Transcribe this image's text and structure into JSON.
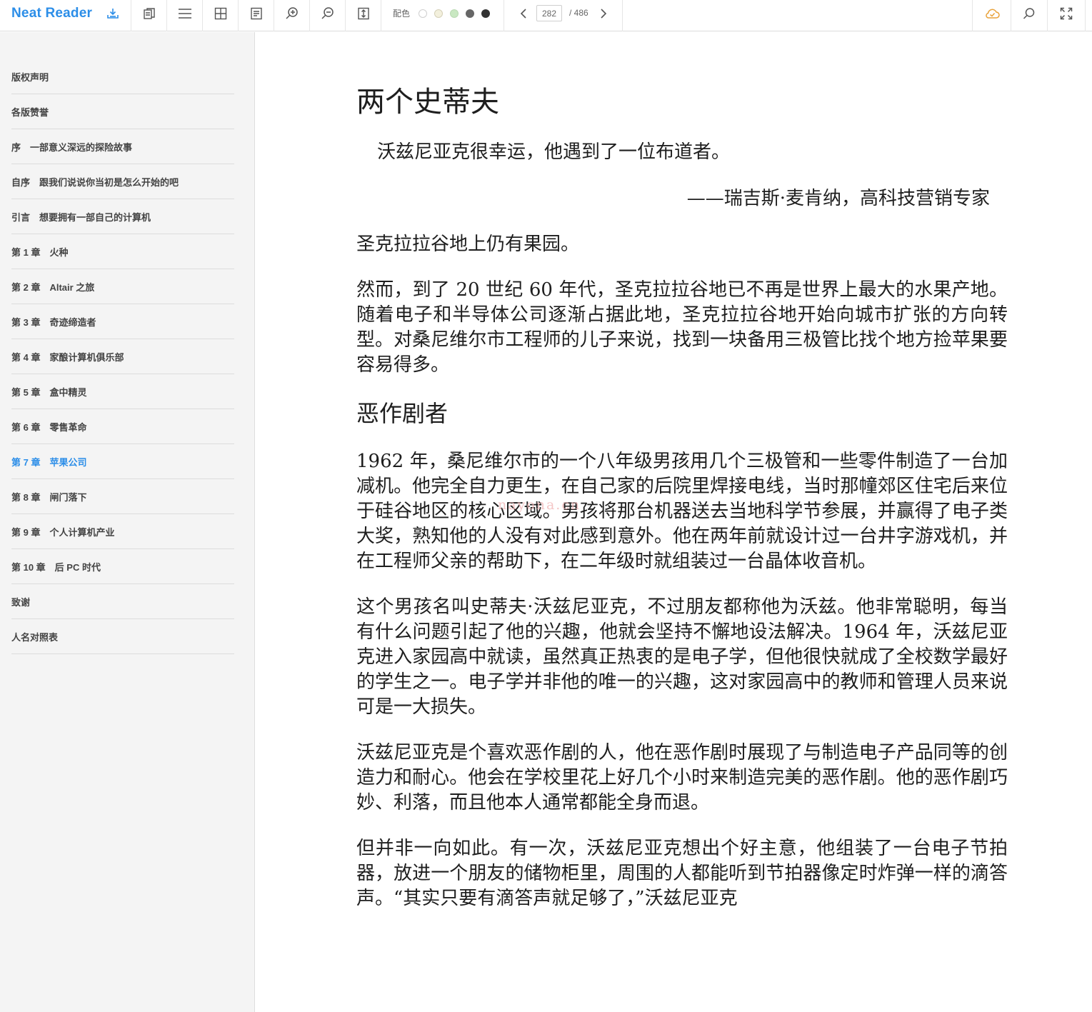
{
  "app": {
    "name": "Neat Reader",
    "accent": "#2c8ee8"
  },
  "toolbar": {
    "icons": [
      "download-icon",
      "copy-icon",
      "menu-icon",
      "grid-icon",
      "notes-icon",
      "zoom-in-icon",
      "zoom-out-icon",
      "fit-height-icon"
    ],
    "color_label": "配色",
    "color_swatches": [
      "#ffffff",
      "#f3f0dd",
      "#c9e8c2",
      "#666666",
      "#333333"
    ],
    "page_current": "282",
    "page_total": "/ 486",
    "right_icons": [
      "cloud-sync-icon",
      "search-icon",
      "fullscreen-icon"
    ]
  },
  "sidebar": {
    "items": [
      {
        "label": "版权声明",
        "active": false
      },
      {
        "label": "各版赞誉",
        "active": false
      },
      {
        "label": "序　一部意义深远的探险故事",
        "active": false
      },
      {
        "label": "自序　跟我们说说你当初是怎么开始的吧",
        "active": false
      },
      {
        "label": "引言　想要拥有一部自己的计算机",
        "active": false
      },
      {
        "label": "第 1 章　火种",
        "active": false
      },
      {
        "label": "第 2 章　Altair 之旅",
        "active": false
      },
      {
        "label": "第 3 章　奇迹缔造者",
        "active": false
      },
      {
        "label": "第 4 章　家酿计算机俱乐部",
        "active": false
      },
      {
        "label": "第 5 章　盒中精灵",
        "active": false
      },
      {
        "label": "第 6 章　零售革命",
        "active": false
      },
      {
        "label": "第 7 章　苹果公司",
        "active": true
      },
      {
        "label": "第 8 章　闸门落下",
        "active": false
      },
      {
        "label": "第 9 章　个人计算机产业",
        "active": false
      },
      {
        "label": "第 10 章　后 PC 时代",
        "active": false
      },
      {
        "label": "致谢",
        "active": false
      },
      {
        "label": "人名对照表",
        "active": false
      }
    ]
  },
  "content": {
    "title": "两个史蒂夫",
    "epigraph": "沃兹尼亚克很幸运，他遇到了一位布道者。",
    "epigraph_source": "——瑞吉斯·麦肯纳，高科技营销专家",
    "p1": "圣克拉拉谷地上仍有果园。",
    "p2": "然而，到了 20 世纪 60 年代，圣克拉拉谷地已不再是世界上最大的水果产地。随着电子和半导体公司逐渐占据此地，圣克拉拉谷地开始向城市扩张的方向转型。对桑尼维尔市工程师的儿子来说，找到一块备用三极管比找个地方捡苹果要容易得多。",
    "section": "恶作剧者",
    "p3": "1962 年，桑尼维尔市的一个八年级男孩用几个三极管和一些零件制造了一台加减机。他完全自力更生，在自己家的后院里焊接电线，当时那幢郊区住宅后来位于硅谷地区的核心区域。男孩将那台机器送去当地科学节参展，并赢得了电子类大奖，熟知他的人没有对此感到意外。他在两年前就设计过一台井字游戏机，并在工程师父亲的帮助下，在二年级时就组装过一台晶体收音机。",
    "p4": "这个男孩名叫史蒂夫·沃兹尼亚克，不过朋友都称他为沃兹。他非常聪明，每当有什么问题引起了他的兴趣，他就会坚持不懈地设法解决。1964 年，沃兹尼亚克进入家园高中就读，虽然真正热衷的是电子学，但他很快就成了全校数学最好的学生之一。电子学并非他的唯一的兴趣，这对家园高中的教师和管理人员来说可是一大损失。",
    "p5": "沃兹尼亚克是个喜欢恶作剧的人，他在恶作剧时展现了与制造电子产品同等的创造力和耐心。他会在学校里花上好几个小时来制造完美的恶作剧。他的恶作剧巧妙、利落，而且他本人通常都能全身而退。",
    "p6": "但并非一向如此。有一次，沃兹尼亚克想出个好主意，他组装了一台电子节拍器，放进一个朋友的储物柜里，周围的人都能听到节拍器像定时炸弹一样的滴答声。“其实只要有滴答声就足够了，”沃兹尼亚克",
    "watermark": "nayona.cn"
  }
}
